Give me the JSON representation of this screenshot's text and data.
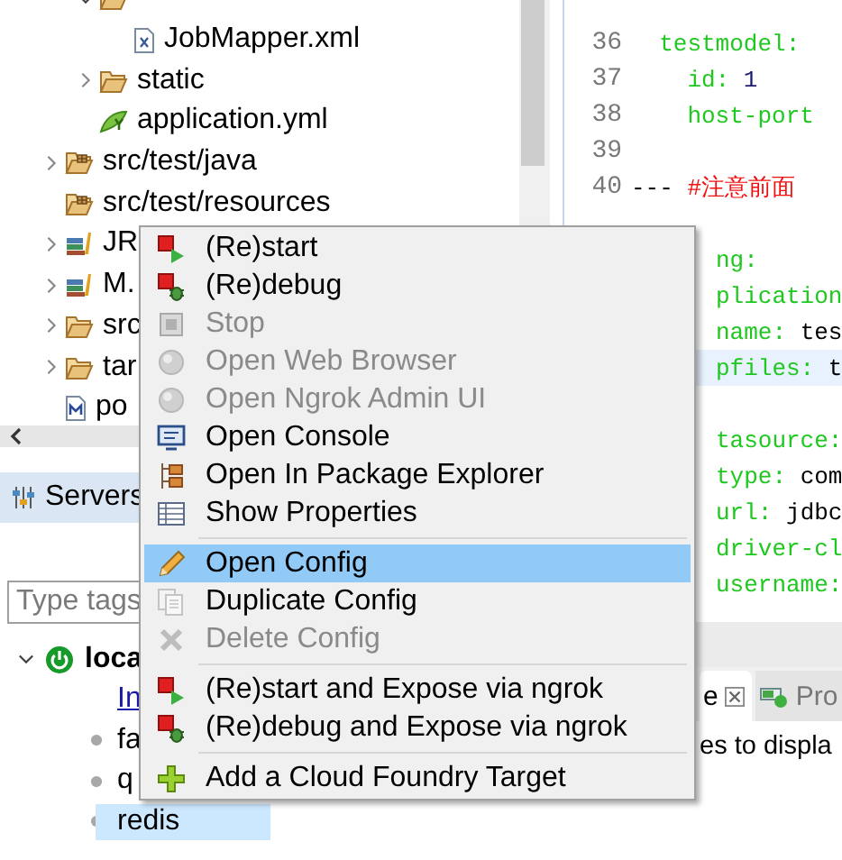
{
  "tree": [
    {
      "children": [
        {
          "kind": "folder",
          "expanded": true,
          "children": [
            {
              "label": "JobMapper.xml",
              "kind": "xml"
            }
          ]
        },
        {
          "label": "static",
          "kind": "folder",
          "expanded": false
        },
        {
          "label": "application.yml",
          "kind": "yml"
        }
      ]
    },
    {
      "label": "src/test/java",
      "kind": "source-folder",
      "expanded": false
    },
    {
      "label": "src/test/resources",
      "kind": "source-folder"
    },
    {
      "label": "JR",
      "kind": "library",
      "expanded": false
    },
    {
      "label": "M.",
      "kind": "library",
      "expanded": false
    },
    {
      "label": "src",
      "kind": "folder",
      "expanded": false
    },
    {
      "label": "tar",
      "kind": "folder",
      "expanded": false
    },
    {
      "label": "po",
      "kind": "maven-file"
    }
  ],
  "servers": {
    "tab": {
      "label": "Servers",
      "selected": true
    },
    "filter": {
      "placeholder": "Type tags"
    },
    "tree": [
      {
        "label": "loca",
        "expanded": true,
        "children": [
          {
            "label": "In",
            "kind": "link",
            "selected": false
          },
          {
            "label": "fa",
            "kind": "app",
            "selected": false
          },
          {
            "label": "q",
            "kind": "app",
            "selected": false
          },
          {
            "label": "redis",
            "kind": "app",
            "selected": true
          }
        ]
      }
    ]
  },
  "editor": {
    "lines": [
      {
        "kind": "full",
        "current": false
      },
      {
        "kind": "full",
        "number": "36",
        "current": false,
        "segments": [
          {
            "text": "  testmodel:",
            "kind": "key"
          }
        ]
      },
      {
        "kind": "full",
        "number": "37",
        "current": false,
        "segments": [
          {
            "text": "    id: ",
            "kind": "key"
          },
          {
            "text": "1",
            "kind": "number"
          }
        ]
      },
      {
        "kind": "full",
        "number": "38",
        "current": false,
        "segments": [
          {
            "text": "    host-port",
            "kind": "key"
          }
        ]
      },
      {
        "kind": "full",
        "number": "39",
        "current": false
      },
      {
        "kind": "full",
        "number": "40",
        "current": false,
        "segments": [
          {
            "text": "--- ",
            "kind": "plain"
          },
          {
            "text": "#注意前面",
            "kind": "comment"
          }
        ]
      },
      {
        "kind": "full",
        "current": false
      },
      {
        "kind": "clipped",
        "current": false,
        "segments": [
          {
            "text": "ng:",
            "kind": "key"
          }
        ]
      },
      {
        "kind": "clipped",
        "current": false,
        "segments": [
          {
            "text": "plication",
            "kind": "key"
          }
        ]
      },
      {
        "kind": "clipped",
        "current": false,
        "segments": [
          {
            "text": "name: ",
            "kind": "key"
          },
          {
            "text": "tes",
            "kind": "plain"
          }
        ]
      },
      {
        "kind": "clipped",
        "current": true,
        "segments": [
          {
            "text": "pfiles: ",
            "kind": "key"
          },
          {
            "text": "t",
            "kind": "plain"
          }
        ]
      },
      {
        "kind": "clipped",
        "current": false
      },
      {
        "kind": "clipped",
        "current": false,
        "segments": [
          {
            "text": "tasource:",
            "kind": "key"
          }
        ]
      },
      {
        "kind": "clipped",
        "current": false,
        "segments": [
          {
            "text": "type: ",
            "kind": "key"
          },
          {
            "text": "com",
            "kind": "plain"
          }
        ]
      },
      {
        "kind": "clipped",
        "current": false,
        "segments": [
          {
            "text": "url: ",
            "kind": "key"
          },
          {
            "text": "jdbc",
            "kind": "plain"
          }
        ]
      },
      {
        "kind": "clipped",
        "current": false,
        "segments": [
          {
            "text": "driver-cl",
            "kind": "key"
          }
        ]
      },
      {
        "kind": "clipped",
        "current": false,
        "segments": [
          {
            "text": "username:",
            "kind": "key"
          }
        ]
      }
    ]
  },
  "bottom_panel": {
    "tabs": [
      {
        "label": "e",
        "selected": true,
        "kind": "plain"
      },
      {
        "label": "Pro",
        "selected": false,
        "kind": "progress"
      }
    ],
    "message": "es to displa"
  },
  "menu": {
    "groups": [
      {
        "items": [
          {
            "label": "(Re)start",
            "kind": "restart",
            "disabled": false,
            "selected": false
          },
          {
            "label": "(Re)debug",
            "kind": "debug",
            "disabled": false,
            "selected": false
          },
          {
            "label": "Stop",
            "kind": "stop",
            "disabled": true,
            "selected": false
          },
          {
            "label": "Open Web Browser",
            "kind": "globe",
            "disabled": true,
            "selected": false
          },
          {
            "label": "Open Ngrok Admin UI",
            "kind": "globe",
            "disabled": true,
            "selected": false
          },
          {
            "label": "Open Console",
            "kind": "console",
            "disabled": false,
            "selected": false
          },
          {
            "label": "Open In Package Explorer",
            "kind": "package",
            "disabled": false,
            "selected": false
          },
          {
            "label": "Show Properties",
            "kind": "properties",
            "disabled": false,
            "selected": false
          }
        ]
      },
      {
        "items": [
          {
            "label": "Open Config",
            "kind": "pencil",
            "disabled": false,
            "selected": true
          },
          {
            "label": "Duplicate Config",
            "kind": "duplicate",
            "disabled": false,
            "selected": false
          },
          {
            "label": "Delete Config",
            "kind": "delete",
            "disabled": true,
            "selected": false
          }
        ]
      },
      {
        "items": [
          {
            "label": "(Re)start and Expose via ngrok",
            "kind": "restart",
            "disabled": false,
            "selected": false
          },
          {
            "label": "(Re)debug and Expose via ngrok",
            "kind": "debug",
            "disabled": false,
            "selected": false
          }
        ]
      },
      {
        "items": [
          {
            "label": "Add a Cloud Foundry Target",
            "kind": "plus",
            "disabled": false,
            "selected": false
          }
        ]
      }
    ]
  }
}
